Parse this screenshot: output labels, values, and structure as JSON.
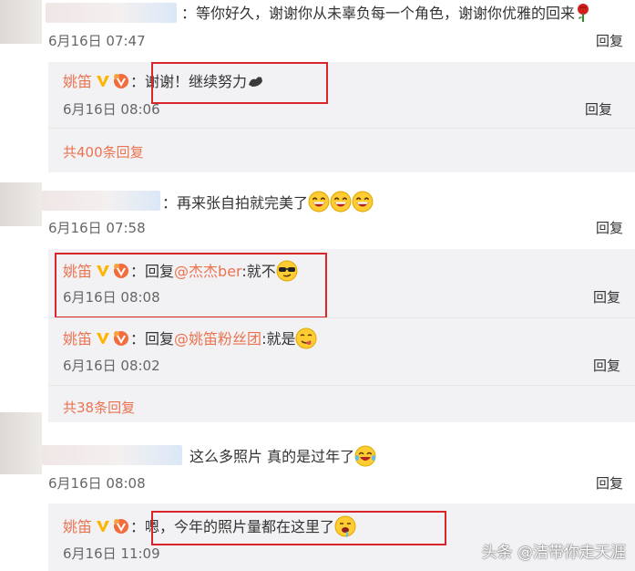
{
  "comments": [
    {
      "text": "：等你好久，谢谢你从未辜负每一个角色，谢谢你优雅的回来",
      "time": "6月16日 07:47",
      "reply_label": "回复",
      "emoji": "rose-icon",
      "replies": [
        {
          "author": "姚笛",
          "colon": "：",
          "text": "谢谢！继续努力",
          "time": "6月16日 08:06",
          "reply_label": "回复",
          "emoji": "flexed-arm-icon"
        }
      ],
      "more_label": "共400条回复"
    },
    {
      "text": "：再来张自拍就完美了",
      "time": "6月16日 07:58",
      "reply_label": "回复",
      "emoji": "grinning-face-icon",
      "replies": [
        {
          "author": "姚笛",
          "colon": "：",
          "prefix": "回复",
          "mention": "@杰杰ber",
          "text": ":就不",
          "time": "6月16日 08:08",
          "reply_label": "回复",
          "emoji": "sunglasses-face-icon"
        },
        {
          "author": "姚笛",
          "colon": "：",
          "prefix": "回复",
          "mention": "@姚笛粉丝团",
          "text": ":就是",
          "time": "6月16日 08:02",
          "reply_label": "回复",
          "emoji": "yum-face-icon"
        }
      ],
      "more_label": "共38条回复"
    },
    {
      "text": "这么多照片 真的是过年了",
      "time": "6月16日 08:08",
      "reply_label": "回复",
      "emoji": "laughing-tears-icon",
      "replies": [
        {
          "author": "姚笛",
          "colon": "：",
          "text": "嗯，今年的照片量都在这里了",
          "time": "6月16日 11:09",
          "emoji": "drooling-face-icon"
        }
      ]
    }
  ],
  "watermark": "头条 @洁带你走天涯",
  "colors": {
    "accent": "#eb7350",
    "highlight_box": "#d8262a",
    "reply_bg": "#f2f2f5",
    "verified_badge": "#ffb400"
  }
}
